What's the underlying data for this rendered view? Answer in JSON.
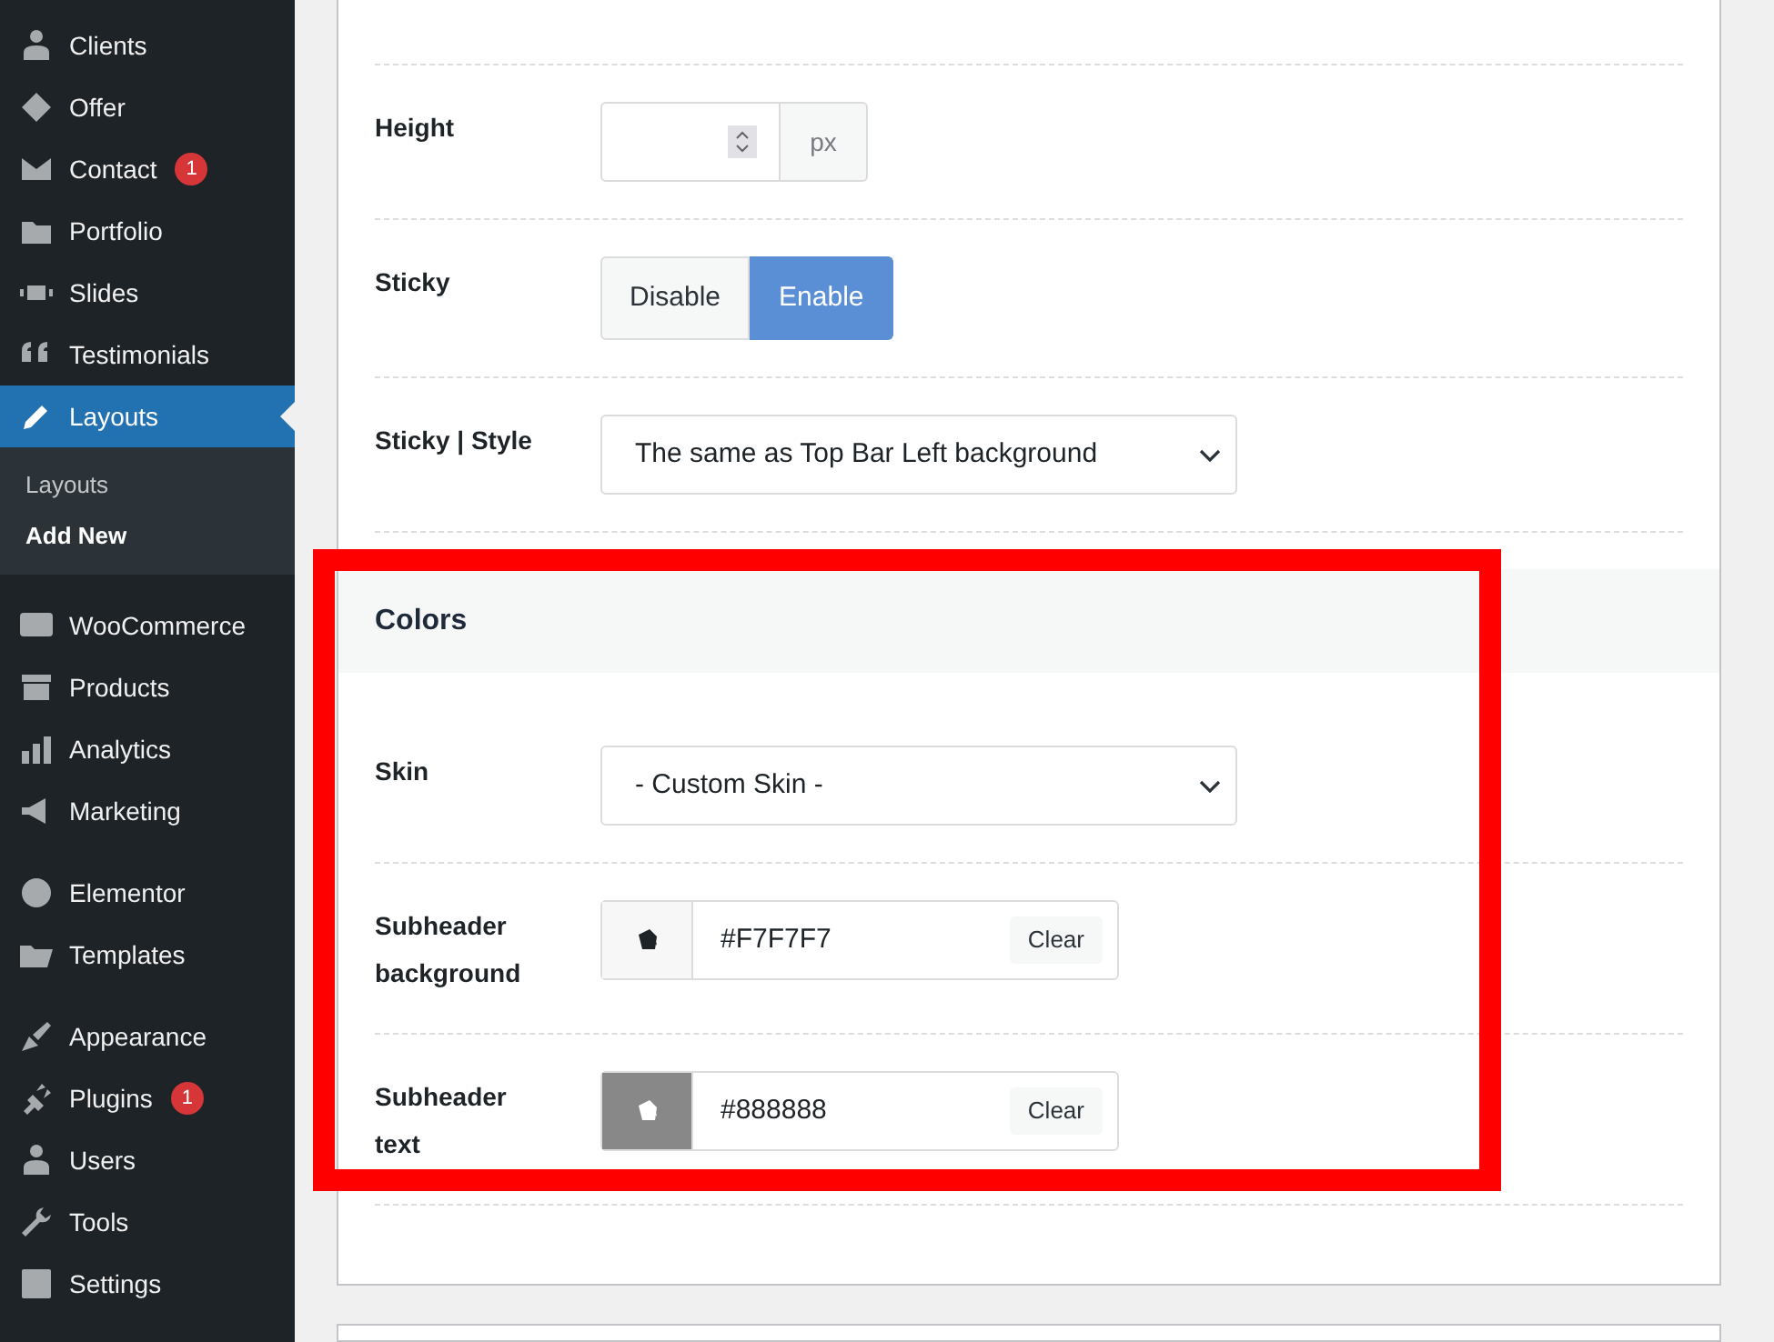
{
  "sidebar": {
    "groups": [
      [
        {
          "label": "Clients",
          "selected": false
        },
        {
          "label": "Offer",
          "selected": false
        },
        {
          "label": "Contact",
          "selected": false,
          "badge": "1"
        },
        {
          "label": "Portfolio",
          "selected": false
        },
        {
          "label": "Slides",
          "selected": false
        },
        {
          "label": "Testimonials",
          "selected": false
        },
        {
          "label": "Layouts",
          "selected": true,
          "submenu": [
            {
              "label": "Layouts",
              "selected": false
            },
            {
              "label": "Add New",
              "selected": true
            }
          ]
        }
      ],
      [
        {
          "label": "WooCommerce",
          "selected": false
        },
        {
          "label": "Products",
          "selected": false
        },
        {
          "label": "Analytics",
          "selected": false
        },
        {
          "label": "Marketing",
          "selected": false
        }
      ],
      [
        {
          "label": "Elementor",
          "selected": false
        },
        {
          "label": "Templates",
          "selected": false
        }
      ],
      [
        {
          "label": "Appearance",
          "selected": false
        },
        {
          "label": "Plugins",
          "selected": false,
          "badge": "1"
        },
        {
          "label": "Users",
          "selected": false
        },
        {
          "label": "Tools",
          "selected": false
        },
        {
          "label": "Settings",
          "selected": false
        }
      ]
    ]
  },
  "sections": [
    {
      "rows": [
        {
          "kind": "number",
          "label": "Height",
          "unit": "px"
        },
        {
          "kind": "toggle",
          "label": "Sticky",
          "options": [
            {
              "label": "Disable",
              "selected": false
            },
            {
              "label": "Enable",
              "selected": true
            }
          ]
        },
        {
          "kind": "select",
          "label": "Sticky | Style",
          "value": "The same as Top Bar Left background"
        }
      ]
    },
    {
      "title": "Colors",
      "rows": [
        {
          "kind": "select",
          "label": "Skin",
          "value": "- Custom Skin -"
        },
        {
          "kind": "color",
          "label": "Subheader background",
          "value": "#F7F7F7",
          "color": "#f7f7f7",
          "button": "Clear"
        },
        {
          "kind": "color",
          "label": "Subheader text",
          "value": "#888888",
          "color": "#888888",
          "button": "Clear"
        }
      ]
    }
  ],
  "annotation_frame": true
}
